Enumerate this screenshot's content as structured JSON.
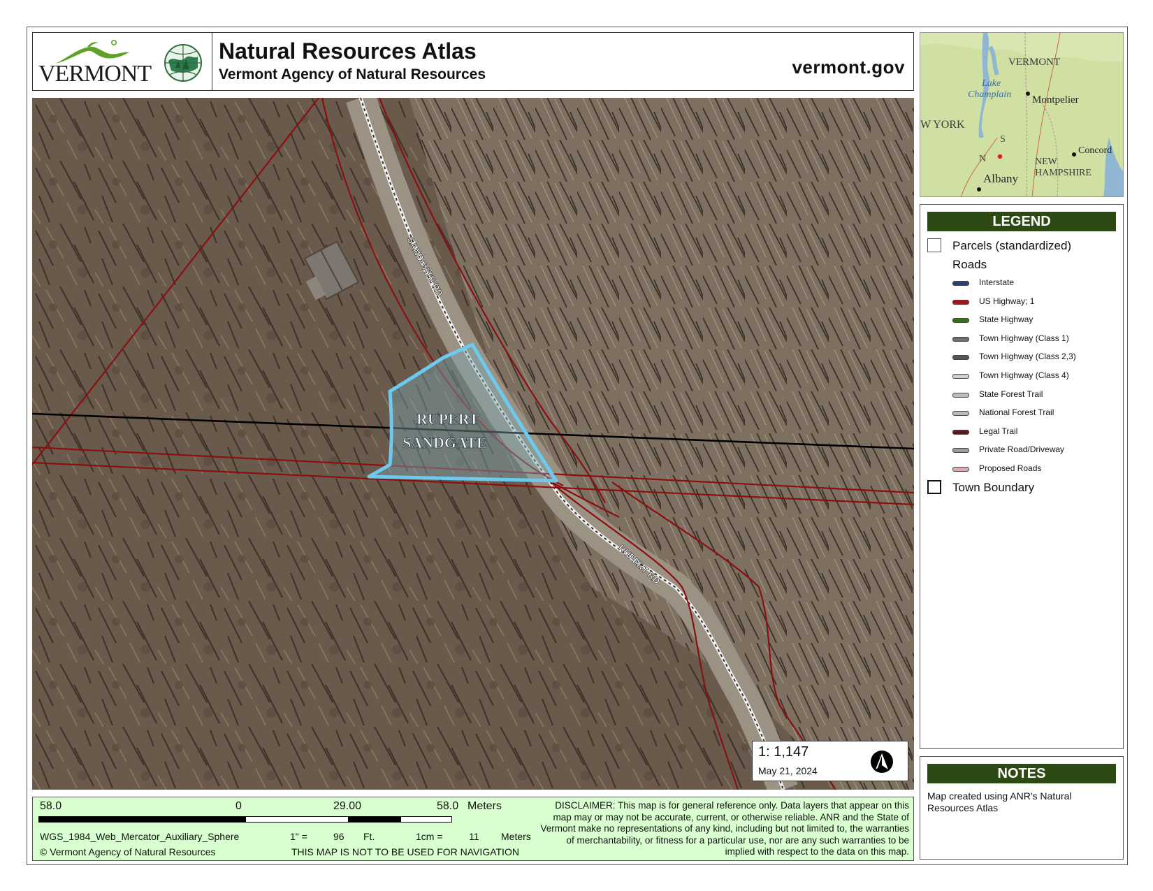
{
  "header": {
    "logo_text": "VERMONT",
    "title": "Natural Resources Atlas",
    "subtitle": "Vermont Agency of Natural Resources",
    "site": "vermont.gov"
  },
  "locator": {
    "labels": {
      "vermont": "VERMONT",
      "lake": "Lake",
      "champlain": "Champlain",
      "montpelier": "Montpelier",
      "new_york": "W YORK",
      "concord": "Concord",
      "new": "NEW",
      "hampshire": "HAMPSHIRE",
      "albany": "Albany"
    }
  },
  "map": {
    "labels": {
      "sandgate_rd": "SANDGATE RD",
      "rupert_rd": "RUPERT RD",
      "town_1": "RUPERT",
      "town_2": "SANDGATE"
    },
    "scale": "1:  1,147",
    "date": "May 21, 2024"
  },
  "legend": {
    "title": "LEGEND",
    "parcels": "Parcels (standardized)",
    "roads": "Roads",
    "items": [
      {
        "label": "Interstate",
        "color": "#2a3f7a"
      },
      {
        "label": "US Highway; 1",
        "color": "#a3141c"
      },
      {
        "label": "State Highway",
        "color": "#3c6e1e"
      },
      {
        "label": "Town Highway (Class 1)",
        "color": "#6e6e6e"
      },
      {
        "label": "Town Highway (Class 2,3)",
        "color": "#555555"
      },
      {
        "label": "Town Highway (Class 4)",
        "color": "#cfcfcf"
      },
      {
        "label": "State Forest Trail",
        "color": "#bbbbbb"
      },
      {
        "label": "National Forest Trail",
        "color": "#bbbbbb"
      },
      {
        "label": "Legal Trail",
        "color": "#5a1a22"
      },
      {
        "label": "Private Road/Driveway",
        "color": "#9a9a9a"
      },
      {
        "label": "Proposed Roads",
        "color": "#e4a7a7"
      }
    ],
    "town_boundary": "Town Boundary"
  },
  "notes": {
    "title": "NOTES",
    "text": "Map created using ANR's Natural Resources Atlas"
  },
  "footer": {
    "scale_left": "58.0",
    "scale_zero": "0",
    "scale_mid": "29.00",
    "scale_right": "58.0",
    "scale_units": "Meters",
    "projection": "WGS_1984_Web_Mercator_Auxiliary_Sphere",
    "copyright": "© Vermont Agency of Natural Resources",
    "inch_label": "1\" =",
    "inch_value": "96",
    "inch_units": "Ft.",
    "cm_label": "1cm =",
    "cm_value": "11",
    "cm_units": "Meters",
    "navigation": "THIS MAP IS NOT TO BE USED FOR NAVIGATION",
    "disclaimer": "DISCLAIMER: This map is for general reference only. Data layers that appear on this map may or may not be accurate, current, or otherwise reliable. ANR and the State of Vermont make no representations of any kind, including but not limited to, the warranties of merchantability, or fitness for a particular use, nor are any such warranties to be implied with respect to the data on this map."
  }
}
